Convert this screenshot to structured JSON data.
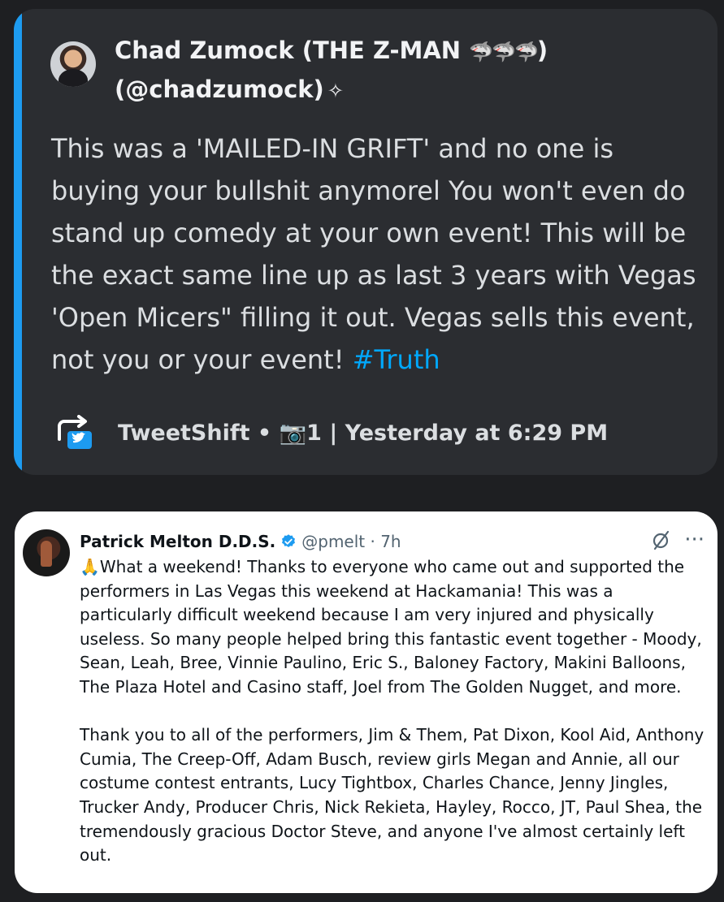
{
  "embed": {
    "author_name": "Chad Zumock (THE Z-MAN ",
    "author_sharks": "🦈🦈🦈",
    "author_close": ")",
    "author_handle": "(@chadzumock)",
    "author_badge": "✧",
    "body": "This was a 'MAILED-IN GRIFT' and no one is buying your bullshit anymorel You won't even do stand up comedy at your own event! This will be the exact same line up as last 3 years with Vegas 'Open Micers\" filling it out. Vegas sells this event, not you or your event! ",
    "hashtag": "#Truth",
    "footer": "TweetShift • 📷1 | Yesterday at 6:29 PM",
    "accent_color": "#1d9bf0",
    "footer_icon": "retweet-twitter-icon"
  },
  "tweet": {
    "name": "Patrick Melton D.D.S.",
    "handle_time": "@pmelt · 7h",
    "more": "···",
    "paragraph1": "🙏What a weekend! Thanks to everyone who came out and supported the performers in Las Vegas this weekend at Hackamania! This was a particularly difficult weekend because I am very injured and physically useless. So many people helped bring this fantastic event together - Moody, Sean, Leah, Bree, Vinnie Paulino, Eric S., Baloney Factory, Makini Balloons, The Plaza Hotel and Casino staff, Joel from The Golden Nugget, and more.",
    "paragraph2": "Thank you to all of the performers, Jim & Them, Pat Dixon, Kool Aid, Anthony Cumia, The Creep-Off, Adam Busch, review girls Megan and Annie, all our costume contest entrants, Lucy Tightbox, Charles Chance, Jenny Jingles, Trucker Andy, Producer Chris, Nick Rekieta, Hayley, Rocco, JT, Paul Shea, the tremendously gracious Doctor Steve, and anyone I've almost certainly left out.",
    "verified_color": "#1d9bf0"
  }
}
